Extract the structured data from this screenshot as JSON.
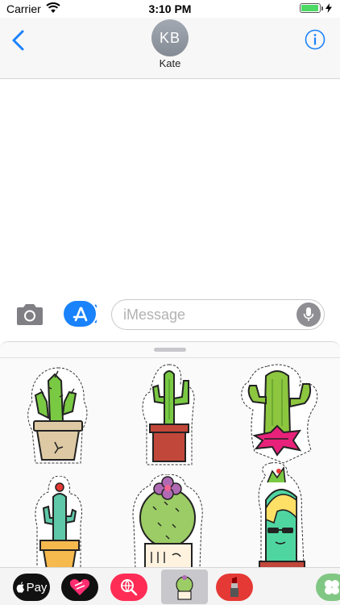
{
  "status": {
    "carrier": "Carrier",
    "time": "3:10 PM",
    "battery_level": 0.95
  },
  "header": {
    "avatar_initials": "KB",
    "contact_name": "Kate"
  },
  "compose": {
    "placeholder": "iMessage"
  },
  "app_strip": {
    "apple_pay_label": "Pay",
    "items": [
      "apple-pay",
      "heart-app",
      "image-search",
      "cactus-stickers",
      "lipstick-app",
      "clover-app"
    ]
  },
  "colors": {
    "accent_blue": "#1a82fb",
    "cactus_green": "#7ac943",
    "pot_terracotta": "#c1473a"
  }
}
